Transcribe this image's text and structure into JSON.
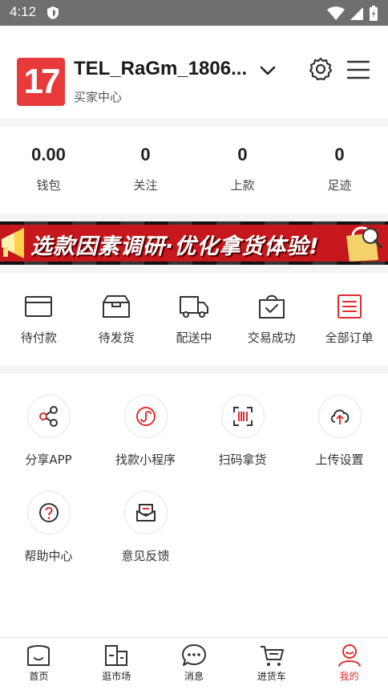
{
  "status_bar": {
    "time": "4:12"
  },
  "header": {
    "logo_text": "17",
    "username": "TEL_RaGm_1806...",
    "subtitle": "买家中心"
  },
  "stats": [
    {
      "value": "0.00",
      "label": "钱包"
    },
    {
      "value": "0",
      "label": "关注"
    },
    {
      "value": "0",
      "label": "上款"
    },
    {
      "value": "0",
      "label": "足迹"
    }
  ],
  "banner": {
    "text": "选款因素调研·优化拿货体验!"
  },
  "orders": [
    {
      "label": "待付款",
      "icon": "card-icon"
    },
    {
      "label": "待发货",
      "icon": "box-icon"
    },
    {
      "label": "配送中",
      "icon": "truck-icon"
    },
    {
      "label": "交易成功",
      "icon": "bag-check-icon"
    },
    {
      "label": "全部订单",
      "icon": "list-icon"
    }
  ],
  "tools": [
    {
      "label": "分享APP",
      "icon": "share-icon"
    },
    {
      "label": "找款小程序",
      "icon": "mini-program-icon"
    },
    {
      "label": "扫码拿货",
      "icon": "scan-icon"
    },
    {
      "label": "上传设置",
      "icon": "cloud-upload-icon"
    },
    {
      "label": "帮助中心",
      "icon": "help-icon"
    },
    {
      "label": "意见反馈",
      "icon": "feedback-icon"
    }
  ],
  "bottom_nav": [
    {
      "label": "首页",
      "icon": "home-icon",
      "active": false
    },
    {
      "label": "逛市场",
      "icon": "market-icon",
      "active": false
    },
    {
      "label": "消息",
      "icon": "message-icon",
      "active": false
    },
    {
      "label": "进货车",
      "icon": "cart-icon",
      "active": false
    },
    {
      "label": "我的",
      "icon": "profile-icon",
      "active": true
    }
  ],
  "colors": {
    "accent": "#e02e2e",
    "logo": "#e83a3a",
    "banner": "#c5171c"
  }
}
